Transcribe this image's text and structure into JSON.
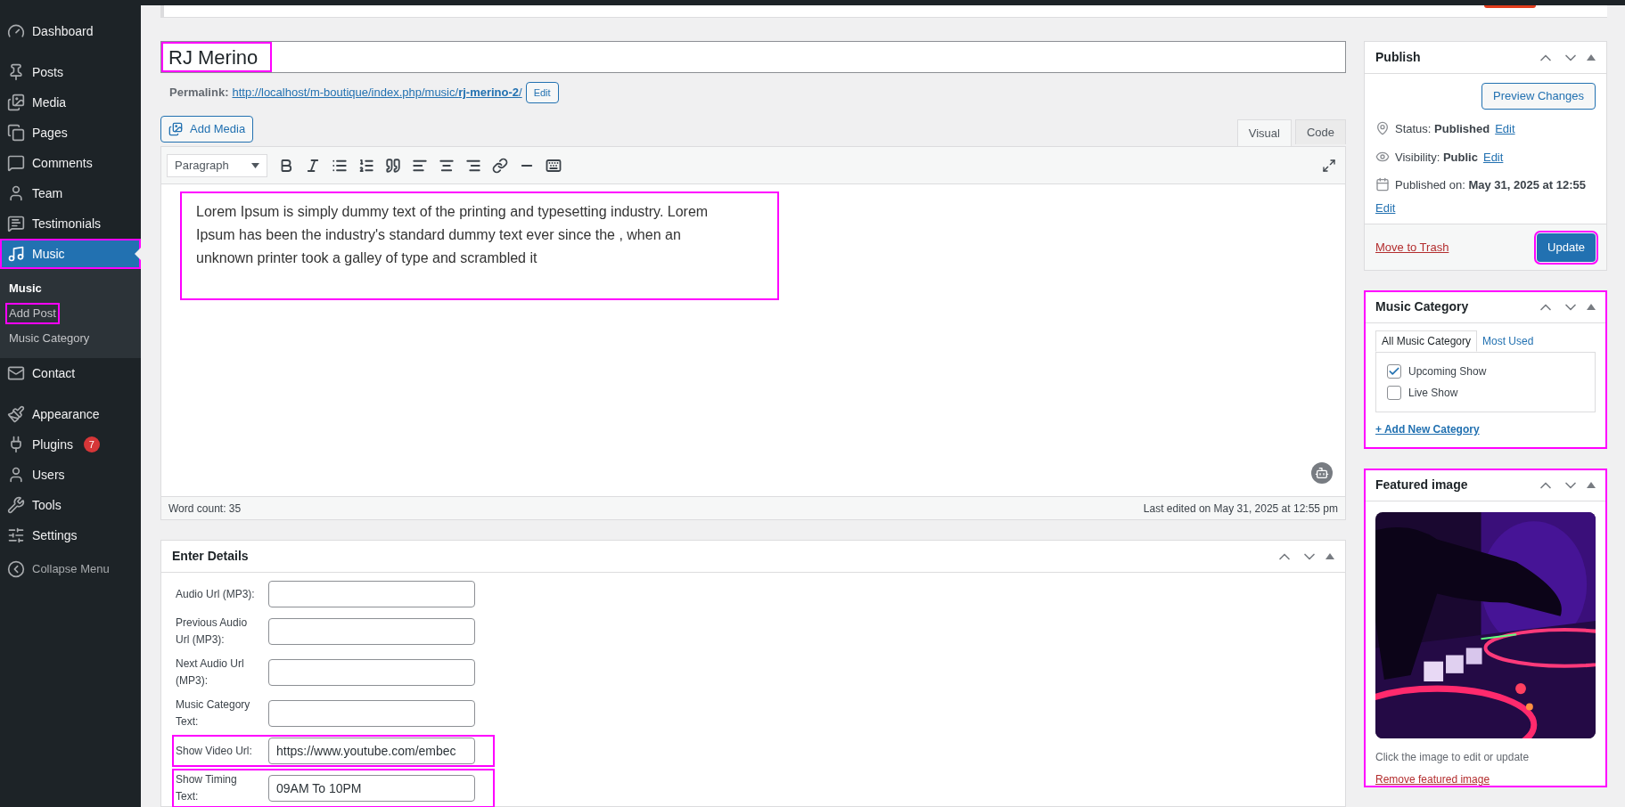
{
  "sidebar": {
    "items": [
      {
        "label": "Dashboard",
        "selected": false,
        "highlighted": false
      },
      {
        "label": "Posts",
        "selected": false,
        "highlighted": false
      },
      {
        "label": "Media",
        "selected": false,
        "highlighted": false
      },
      {
        "label": "Pages",
        "selected": false,
        "highlighted": false
      },
      {
        "label": "Comments",
        "selected": false,
        "highlighted": false
      },
      {
        "label": "Team",
        "selected": false,
        "highlighted": false
      },
      {
        "label": "Testimonials",
        "selected": false,
        "highlighted": false
      },
      {
        "label": "Music",
        "selected": true,
        "highlighted": true,
        "submenu": [
          {
            "label": "Music",
            "selected": true,
            "highlighted": false
          },
          {
            "label": "Add Post",
            "selected": false,
            "highlighted": true
          },
          {
            "label": "Music Category",
            "selected": false,
            "highlighted": false
          }
        ]
      },
      {
        "label": "Contact",
        "selected": false,
        "highlighted": false
      },
      {
        "label": "Appearance",
        "selected": false,
        "highlighted": false
      },
      {
        "label": "Plugins",
        "selected": false,
        "highlighted": false,
        "badge": "7"
      },
      {
        "label": "Users",
        "selected": false,
        "highlighted": false
      },
      {
        "label": "Tools",
        "selected": false,
        "highlighted": false
      },
      {
        "label": "Settings",
        "selected": false,
        "highlighted": false
      }
    ],
    "collapse": "Collapse Menu"
  },
  "title": {
    "value": "RJ Merino",
    "highlighted": true
  },
  "permalink": {
    "label": "Permalink:",
    "url": "http://localhost/m-boutique/index.php/music/**rj-merino-2**/",
    "edit": "Edit"
  },
  "add_media": "Add Media",
  "editor_tabs": [
    {
      "label": "Visual",
      "selected": true
    },
    {
      "label": "Code",
      "selected": false
    }
  ],
  "format_select": "Paragraph",
  "content": {
    "text": "Lorem Ipsum is simply dummy text of the printing and typesetting industry. Lorem Ipsum has been the industry's standard dummy text ever since the , when an unknown printer took a galley of type and scrambled it",
    "highlighted": true
  },
  "word_count": "Word count: 35",
  "last_edited": "Last edited on May 31, 2025 at 12:55 pm",
  "details": {
    "title": "Enter Details",
    "fields": [
      {
        "label": "Audio Url (MP3):",
        "highlighted": false
      },
      {
        "label": "Previous Audio Url (MP3):",
        "highlighted": false
      },
      {
        "label": "Next Audio Url (MP3):",
        "highlighted": false
      },
      {
        "label": "Music Category Text:",
        "highlighted": false
      },
      {
        "label": "Show Video Url:",
        "value": "https://www.youtube.com/embec",
        "highlighted": true
      },
      {
        "label": "Show Timing Text:",
        "value": "09AM To 10PM",
        "highlighted": true
      }
    ]
  },
  "publish": {
    "title": "Publish",
    "preview": "Preview Changes",
    "rows": [
      {
        "text": "Status: **Published**",
        "edit": "Edit"
      },
      {
        "text": "Visibility: **Public**",
        "edit": "Edit"
      },
      {
        "text": "Published on: **May 31, 2025 at 12:55**",
        "edit": "Edit"
      }
    ],
    "trash": "Move to Trash",
    "update": {
      "label": "Update",
      "highlighted": true
    }
  },
  "category": {
    "title": "Music Category",
    "highlighted": true,
    "tabs": [
      {
        "label": "All Music Category",
        "selected": true
      },
      {
        "label": "Most Used",
        "selected": false
      }
    ],
    "items": [
      {
        "label": "Upcoming Show",
        "checked": true
      },
      {
        "label": "Live Show",
        "checked": false
      }
    ],
    "add": "+ Add New Category"
  },
  "featured": {
    "title": "Featured image",
    "highlighted": true,
    "hint": "Click the image to edit or update",
    "remove": "Remove featured image"
  }
}
